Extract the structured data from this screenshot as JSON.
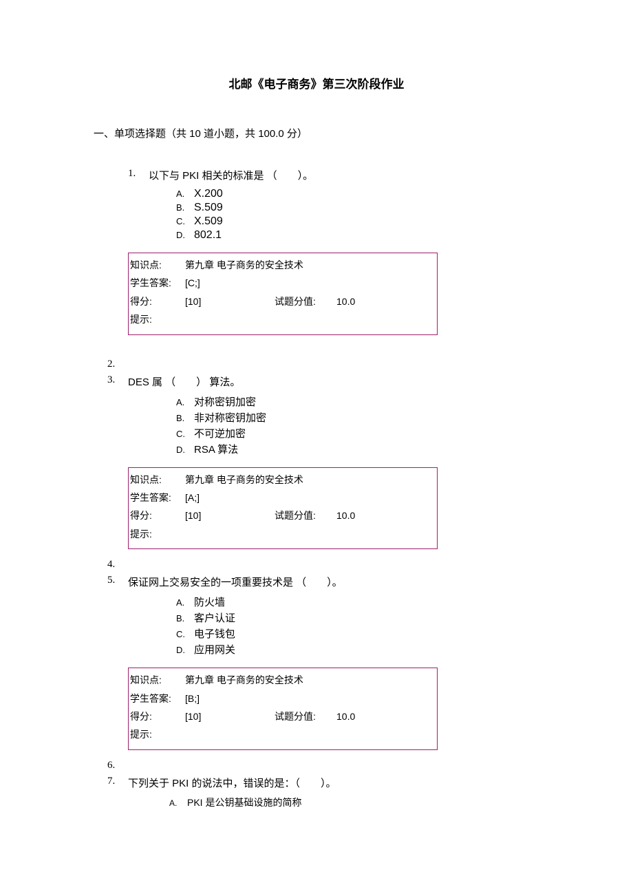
{
  "title": "北邮《电子商务》第三次阶段作业",
  "section_header": "一、单项选择题（共 10 道小题，共 100.0 分）",
  "questions": [
    {
      "num": "1.",
      "text": "以下与 PKI 相关的标准是 （　　）。",
      "options": [
        {
          "letter": "A.",
          "text": "X.200"
        },
        {
          "letter": "B.",
          "text": "S.509"
        },
        {
          "letter": "C.",
          "text": "X.509"
        },
        {
          "letter": "D.",
          "text": "802.1"
        }
      ],
      "answer_box": {
        "zsd_label": "知识点:",
        "zsd_value": "第九章  电子商务的安全技术",
        "xsda_label": "学生答案:",
        "xsda_value": "[C;]",
        "df_label": "得分:",
        "df_value": "[10]",
        "stfz_label": "试题分值:",
        "stfz_value": "10.0",
        "ts_label": "提示:"
      }
    },
    {
      "num": "3.",
      "empty_before": "2.",
      "text": "DES 属 （　　） 算法。",
      "options": [
        {
          "letter": "A.",
          "text": "对称密钥加密"
        },
        {
          "letter": "B.",
          "text": "非对称密钥加密"
        },
        {
          "letter": "C.",
          "text": "不可逆加密"
        },
        {
          "letter": "D.",
          "text": "RSA 算法"
        }
      ],
      "answer_box": {
        "zsd_label": "知识点:",
        "zsd_value": "第九章  电子商务的安全技术",
        "xsda_label": "学生答案:",
        "xsda_value": "[A;]",
        "df_label": "得分:",
        "df_value": "[10]",
        "stfz_label": "试题分值:",
        "stfz_value": "10.0",
        "ts_label": "提示:"
      }
    },
    {
      "num": "5.",
      "empty_before": "4.",
      "text": "保证网上交易安全的一项重要技术是 （　　）。",
      "options": [
        {
          "letter": "A.",
          "text": "防火墙"
        },
        {
          "letter": "B.",
          "text": "客户认证"
        },
        {
          "letter": "C.",
          "text": "电子钱包"
        },
        {
          "letter": "D.",
          "text": "应用网关"
        }
      ],
      "answer_box": {
        "zsd_label": "知识点:",
        "zsd_value": "第九章  电子商务的安全技术",
        "xsda_label": "学生答案:",
        "xsda_value": "[B;]",
        "df_label": "得分:",
        "df_value": "[10]",
        "stfz_label": "试题分值:",
        "stfz_value": "10.0",
        "ts_label": "提示:"
      }
    },
    {
      "num": "7.",
      "empty_before": "6.",
      "text": "下列关于 PKI 的说法中，错误的是：（　　）。",
      "options": [
        {
          "letter": "A.",
          "text": "PKI 是公钥基础设施的简称"
        }
      ]
    }
  ]
}
